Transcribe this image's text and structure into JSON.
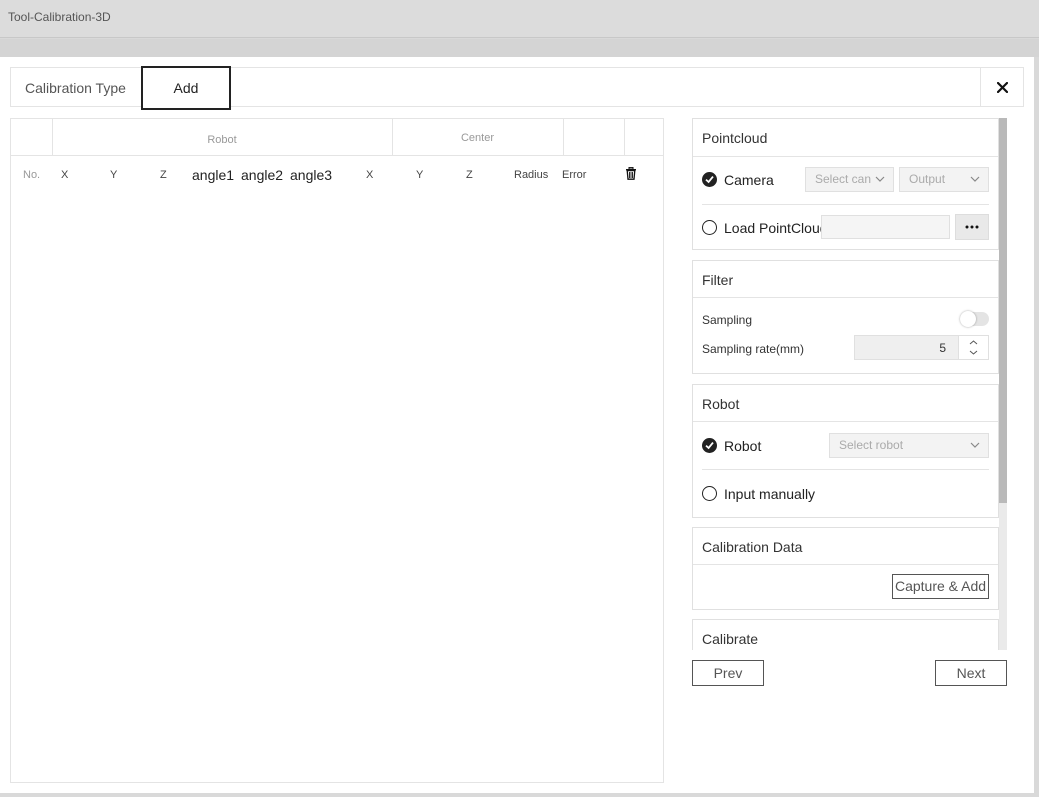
{
  "app": {
    "title": "Tool-Calibration-3D"
  },
  "header": {
    "calibration_type_label": "Calibration Type",
    "add_tab_label": "Add"
  },
  "table": {
    "group_robot": "Robot",
    "group_center": "Center",
    "columns": {
      "no": "No.",
      "x": "X",
      "y": "Y",
      "z": "Z",
      "angle1": "angle1",
      "angle2": "angle2",
      "angle3": "angle3",
      "cx": "X",
      "cy": "Y",
      "cz": "Z",
      "radius": "Radius",
      "error": "Error"
    }
  },
  "pointcloud": {
    "title": "Pointcloud",
    "camera_label": "Camera",
    "camera_select": "Select can",
    "output_select": "Output",
    "load_label": "Load PointCloud",
    "load_path": ""
  },
  "filter": {
    "title": "Filter",
    "sampling_label": "Sampling",
    "sampling_enabled": false,
    "sampling_rate_label": "Sampling rate(mm)",
    "sampling_rate_value": "5"
  },
  "robot": {
    "title": "Robot",
    "robot_label": "Robot",
    "robot_select": "Select robot",
    "manual_label": "Input manually"
  },
  "calibration_data": {
    "title": "Calibration Data",
    "capture_label": "Capture & Add"
  },
  "calibrate": {
    "title": "Calibrate"
  },
  "nav": {
    "prev_label": "Prev",
    "next_label": "Next"
  }
}
